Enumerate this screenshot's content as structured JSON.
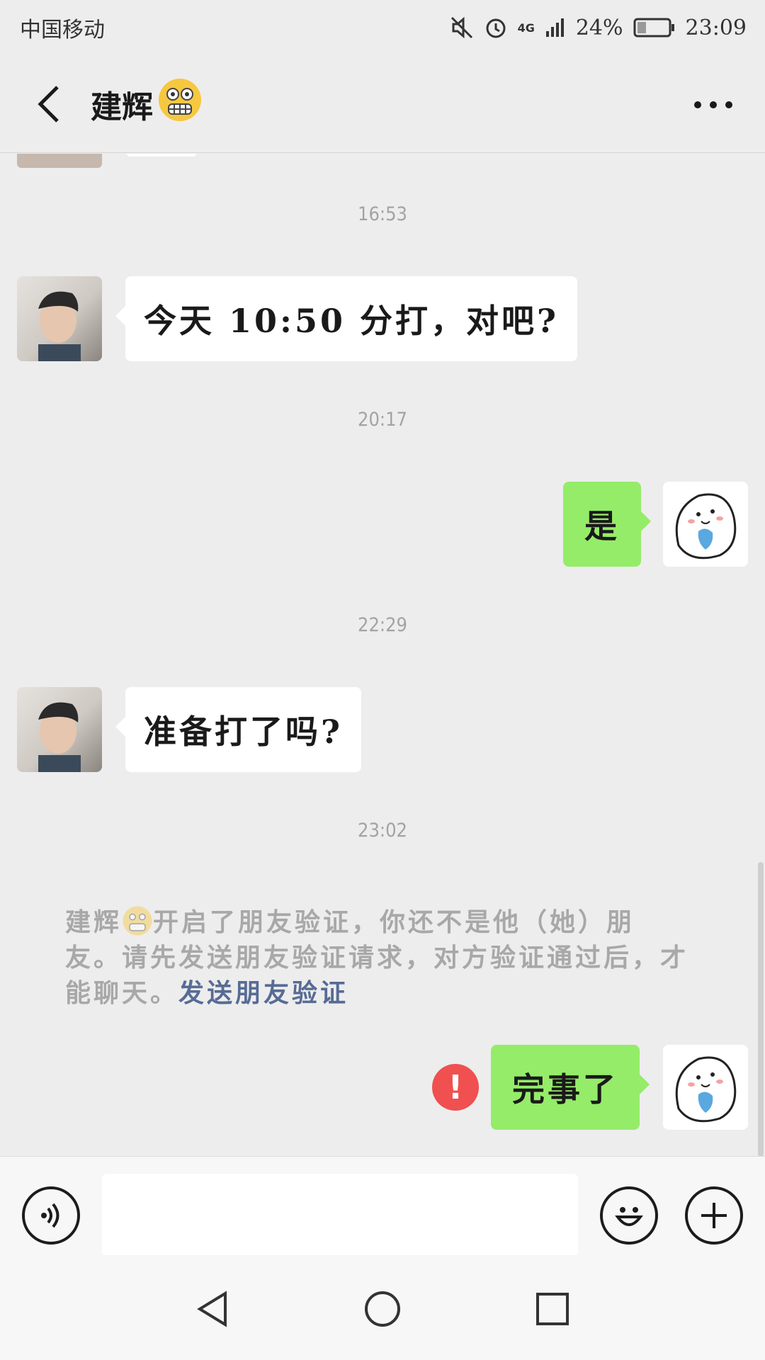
{
  "status_bar": {
    "carrier": "中国移动",
    "network": "4G",
    "battery": "24%",
    "time": "23:09",
    "icons": [
      "mute-icon",
      "alarm-icon",
      "signal-icon",
      "battery-icon"
    ]
  },
  "header": {
    "title": "建辉",
    "title_emoji": "grimacing-face-emoji",
    "back_icon": "back-chevron-icon",
    "more_icon": "more-dots-icon"
  },
  "messages": [
    {
      "type": "timestamp",
      "text": "16:53"
    },
    {
      "type": "incoming",
      "text": "今天 10:50 分打，对吧?"
    },
    {
      "type": "timestamp",
      "text": "20:17"
    },
    {
      "type": "outgoing",
      "text": "是"
    },
    {
      "type": "timestamp",
      "text": "22:29"
    },
    {
      "type": "incoming",
      "text": "准备打了吗?"
    },
    {
      "type": "timestamp",
      "text": "23:02"
    },
    {
      "type": "system",
      "name": "建辉",
      "text": "开启了朋友验证，你还不是他（她）朋友。请先发送朋友验证请求，对方验证通过后，才能聊天。",
      "link": "发送朋友验证"
    },
    {
      "type": "outgoing",
      "text": "完事了",
      "failed": true,
      "failed_icon": "!"
    }
  ],
  "input_bar": {
    "voice_icon": "voice-icon",
    "input_value": "",
    "emoji_icon": "emoji-icon",
    "plus_icon": "plus-icon"
  },
  "nav_bar": {
    "icons": [
      "nav-back-icon",
      "nav-home-icon",
      "nav-recents-icon"
    ]
  },
  "colors": {
    "background": "#ededed",
    "outgoing_bubble": "#95ec69",
    "incoming_bubble": "#ffffff",
    "link": "#576b95",
    "error": "#f05050"
  }
}
